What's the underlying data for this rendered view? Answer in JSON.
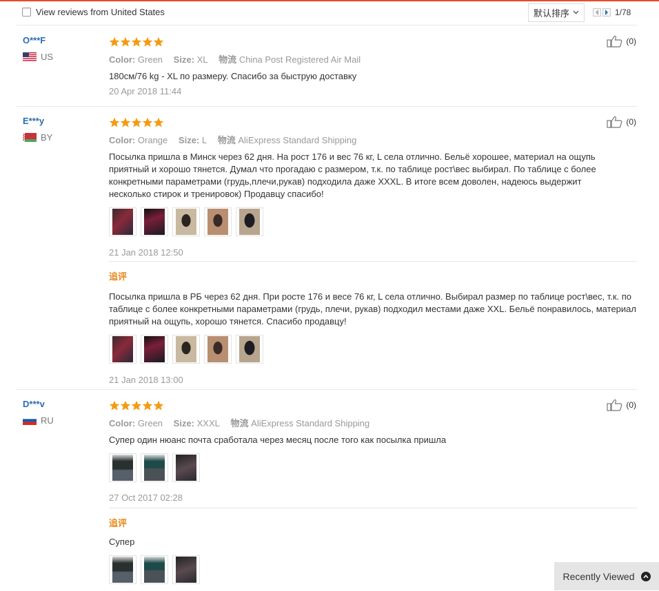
{
  "toolbar": {
    "filter_label": "View reviews from United States",
    "sort_label": "默认排序",
    "page": "1/78"
  },
  "labels": {
    "color": "Color:",
    "size": "Size:",
    "shipping": "物流",
    "followup": "追评"
  },
  "reviews": [
    {
      "user": "O***F",
      "country": "US",
      "rating": 5,
      "color": "Green",
      "size": "XL",
      "shipping": "China Post Registered Air Mail",
      "text": "180см/76 kg - XL по размеру. Спасибо за быструю доставку",
      "date": "20 Apr 2018 11:44",
      "helpful": "(0)"
    },
    {
      "user": "E***y",
      "country": "BY",
      "rating": 5,
      "color": "Orange",
      "size": "L",
      "shipping": "AliExpress Standard Shipping",
      "text": "Посылка пришла в Минск через 62 дня. На рост 176 и вес 76 кг, L села отлично. Бельё хорошее, материал на ощупь приятный и хорошо тянется. Думал что прогадаю с размером, т.к. по таблице рост\\вес выбирал. По таблице с более конкретными параметрами (грудь,плечи,рукав) подходила даже XXXL. В итоге всем доволен, надеюсь выдержит несколько стирок и тренировок) Продавцу спасибо!",
      "date": "21 Jan 2018 12:50",
      "helpful": "(0)",
      "followup_text": "Посылка пришла в РБ через 62 дня. При росте 176 и весе 76 кг, L села отлично. Выбирал размер по таблице рост\\вес, т.к. по таблице с более конкретными параметрами (грудь, плечи, рукав) подходил местами даже XXL. Бельё понравилось, материал приятный на ощупь, хорошо тянется. Спасибо продавцу!",
      "followup_date": "21 Jan 2018 13:00"
    },
    {
      "user": "D***v",
      "country": "RU",
      "rating": 5,
      "color": "Green",
      "size": "XXXL",
      "shipping": "AliExpress Standard Shipping",
      "text": "Супер один нюанс почта сработала через месяц после того как посылка пришла",
      "date": "27 Oct 2017 02:28",
      "helpful": "(0)",
      "followup_text": "Супер"
    }
  ],
  "recently_viewed": "Recently Viewed",
  "colors": {
    "accent": "#e64b2d",
    "username": "#2b6cb0",
    "star": "#f39c12",
    "followup": "#e6891d"
  }
}
